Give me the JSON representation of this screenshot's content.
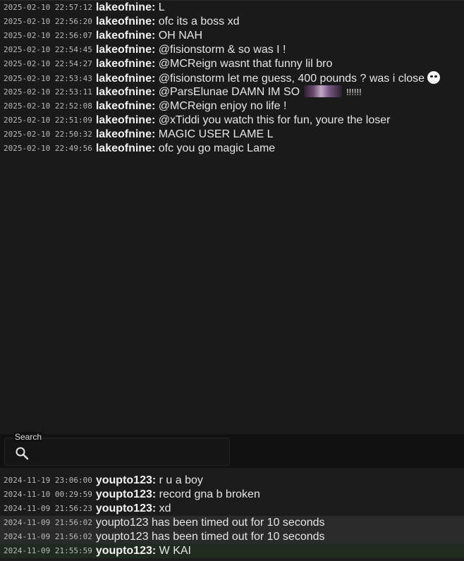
{
  "top_messages": [
    {
      "timestamp": "2025-02-10 22:57:12",
      "user": "lakeofnine:",
      "text": "L"
    },
    {
      "timestamp": "2025-02-10 22:56:20",
      "user": "lakeofnine:",
      "text": "ofc its a boss xd"
    },
    {
      "timestamp": "2025-02-10 22:56:07",
      "user": "lakeofnine:",
      "text": "OH NAH"
    },
    {
      "timestamp": "2025-02-10 22:54:45",
      "user": "lakeofnine:",
      "text": "@fisionstorm & so was I !"
    },
    {
      "timestamp": "2025-02-10 22:54:27",
      "user": "lakeofnine:",
      "text": "@MCReign wasnt that funny lil bro"
    },
    {
      "timestamp": "2025-02-10 22:53:43",
      "user": "lakeofnine:",
      "text": "@fisionstorm let me guess, 400 pounds ? was i close"
    },
    {
      "timestamp": "2025-02-10 22:53:11",
      "user": "lakeofnine:",
      "text": "@ParsElunae DAMN IM SO",
      "text_after": "!!!!!!"
    },
    {
      "timestamp": "2025-02-10 22:52:08",
      "user": "lakeofnine:",
      "text": "@MCReign enjoy no life !"
    },
    {
      "timestamp": "2025-02-10 22:51:09",
      "user": "lakeofnine:",
      "text": "@xTiddi you watch this for fun, youre the loser"
    },
    {
      "timestamp": "2025-02-10 22:50:32",
      "user": "lakeofnine:",
      "text": "MAGIC USER LAME L"
    },
    {
      "timestamp": "2025-02-10 22:49:56",
      "user": "lakeofnine:",
      "text": "ofc you go magic Lame"
    }
  ],
  "search": {
    "label": "Search",
    "placeholder": "",
    "value": "",
    "icon": "search-icon"
  },
  "bottom_messages": [
    {
      "timestamp": "2024-11-19 23:06:00",
      "user": "youpto123:",
      "text": "r u a boy"
    },
    {
      "timestamp": "2024-11-10 00:29:59",
      "user": "youpto123:",
      "text": "record gna b broken"
    },
    {
      "timestamp": "2024-11-09 21:56:23",
      "user": "youpto123:",
      "text": "xd"
    },
    {
      "timestamp": "2024-11-09 21:56:02",
      "system": "youpto123 has been timed out for 10 seconds"
    },
    {
      "timestamp": "2024-11-09 21:56:02",
      "system": "youpto123 has been timed out for 10 seconds"
    },
    {
      "timestamp": "2024-11-09 21:55:59",
      "user": "youpto123:",
      "text": "W KAI"
    }
  ],
  "colors": {
    "background": "#1a1a1a",
    "timeout_row": "#2a2a2a",
    "highlight_row": "#1f2b1f"
  }
}
